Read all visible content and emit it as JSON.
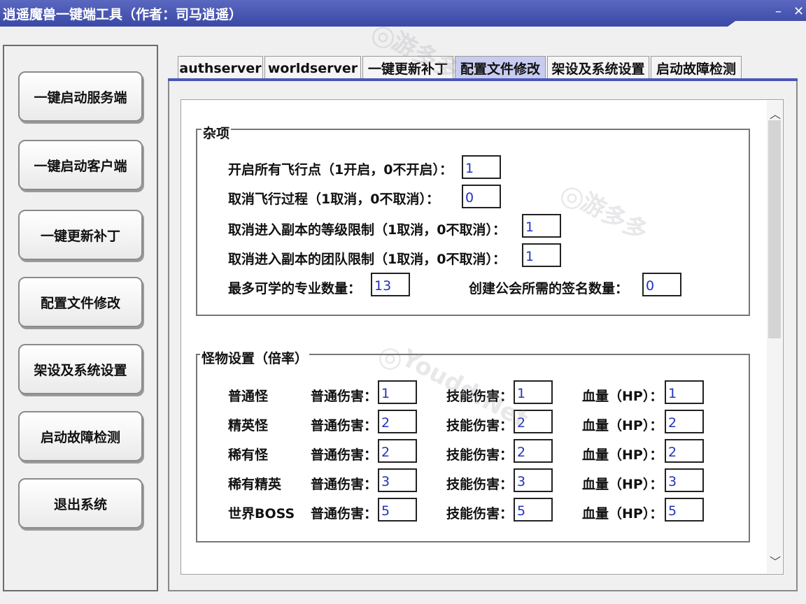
{
  "window": {
    "title": "逍遥魔兽一键端工具（作者：司马逍遥）",
    "min_icon": "minimize-icon",
    "close_icon": "close-icon"
  },
  "sidebar": {
    "buttons": [
      {
        "label": "一键启动服务端"
      },
      {
        "label": "一键启动客户端"
      },
      {
        "label": "一键更新补丁"
      },
      {
        "label": "配置文件修改"
      },
      {
        "label": "架设及系统设置"
      },
      {
        "label": "启动故障检测"
      },
      {
        "label": "退出系统"
      }
    ]
  },
  "tabs": [
    {
      "label": "authserver"
    },
    {
      "label": "worldserver"
    },
    {
      "label": "一键更新补丁"
    },
    {
      "label": "配置文件修改",
      "active": true
    },
    {
      "label": "架设及系统设置"
    },
    {
      "label": "启动故障检测"
    }
  ],
  "misc": {
    "title": "杂项",
    "fly_all_label": "开启所有飞行点（1开启，0不开启）：",
    "fly_all_value": "1",
    "skip_flight_label": "取消飞行过程（1取消，0不取消）：",
    "skip_flight_value": "0",
    "instance_level_label": "取消进入副本的等级限制（1取消，0不取消）：",
    "instance_level_value": "1",
    "instance_party_label": "取消进入副本的团队限制（1取消，0不取消）：",
    "instance_party_value": "1",
    "max_professions_label": "最多可学的专业数量：",
    "max_professions_value": "13",
    "guild_signatures_label": "创建公会所需的签名数量：",
    "guild_signatures_value": "0"
  },
  "monsters": {
    "title": "怪物设置（倍率）",
    "normal_damage_label": "普通伤害：",
    "skill_damage_label": "技能伤害：",
    "hp_label": "血量（HP）：",
    "rows": [
      {
        "name": "普通怪",
        "normal": "1",
        "skill": "1",
        "hp": "1"
      },
      {
        "name": "精英怪",
        "normal": "2",
        "skill": "2",
        "hp": "2"
      },
      {
        "name": "稀有怪",
        "normal": "2",
        "skill": "2",
        "hp": "2"
      },
      {
        "name": "稀有精英",
        "normal": "3",
        "skill": "3",
        "hp": "3"
      },
      {
        "name": "世界BOSS",
        "normal": "5",
        "skill": "5",
        "hp": "5"
      }
    ]
  },
  "watermark": {
    "brand": "游多多",
    "site": "Youdd.Net"
  }
}
